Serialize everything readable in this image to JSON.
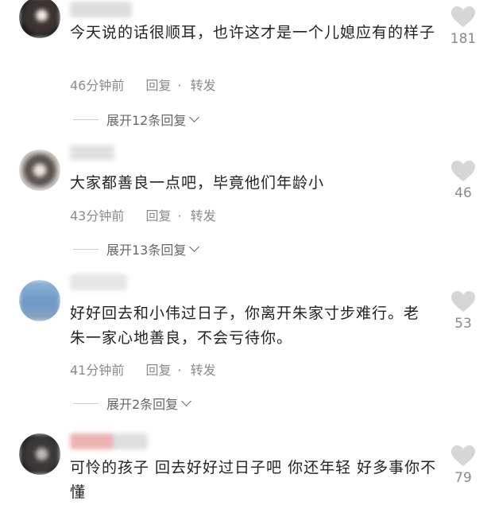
{
  "comments": [
    {
      "text": "今天说的话很顺耳，也许这才是一个儿媳应有的样子",
      "time": "46分钟前",
      "reply": "回复",
      "forward": "转发",
      "expand": "展开12条回复",
      "likes": "181"
    },
    {
      "text": "大家都善良一点吧，毕竟他们年龄小",
      "time": "43分钟前",
      "reply": "回复",
      "forward": "转发",
      "expand": "展开13条回复",
      "likes": "46"
    },
    {
      "text": "好好回去和小伟过日子，你离开朱家寸步难行。老朱一家心地善良，不会亏待你。",
      "time": "41分钟前",
      "reply": "回复",
      "forward": "转发",
      "expand": "展开2条回复",
      "likes": "53"
    },
    {
      "text": "可怜的孩子 回去好好过日子吧 你还年轻 好多事你不懂",
      "likes": "79"
    }
  ],
  "icons": {
    "like": "heart-icon",
    "expand": "chevron-down-icon"
  },
  "colors": {
    "text": "#222222",
    "meta": "#8a8a8a",
    "heart": "#d6d6d6"
  }
}
